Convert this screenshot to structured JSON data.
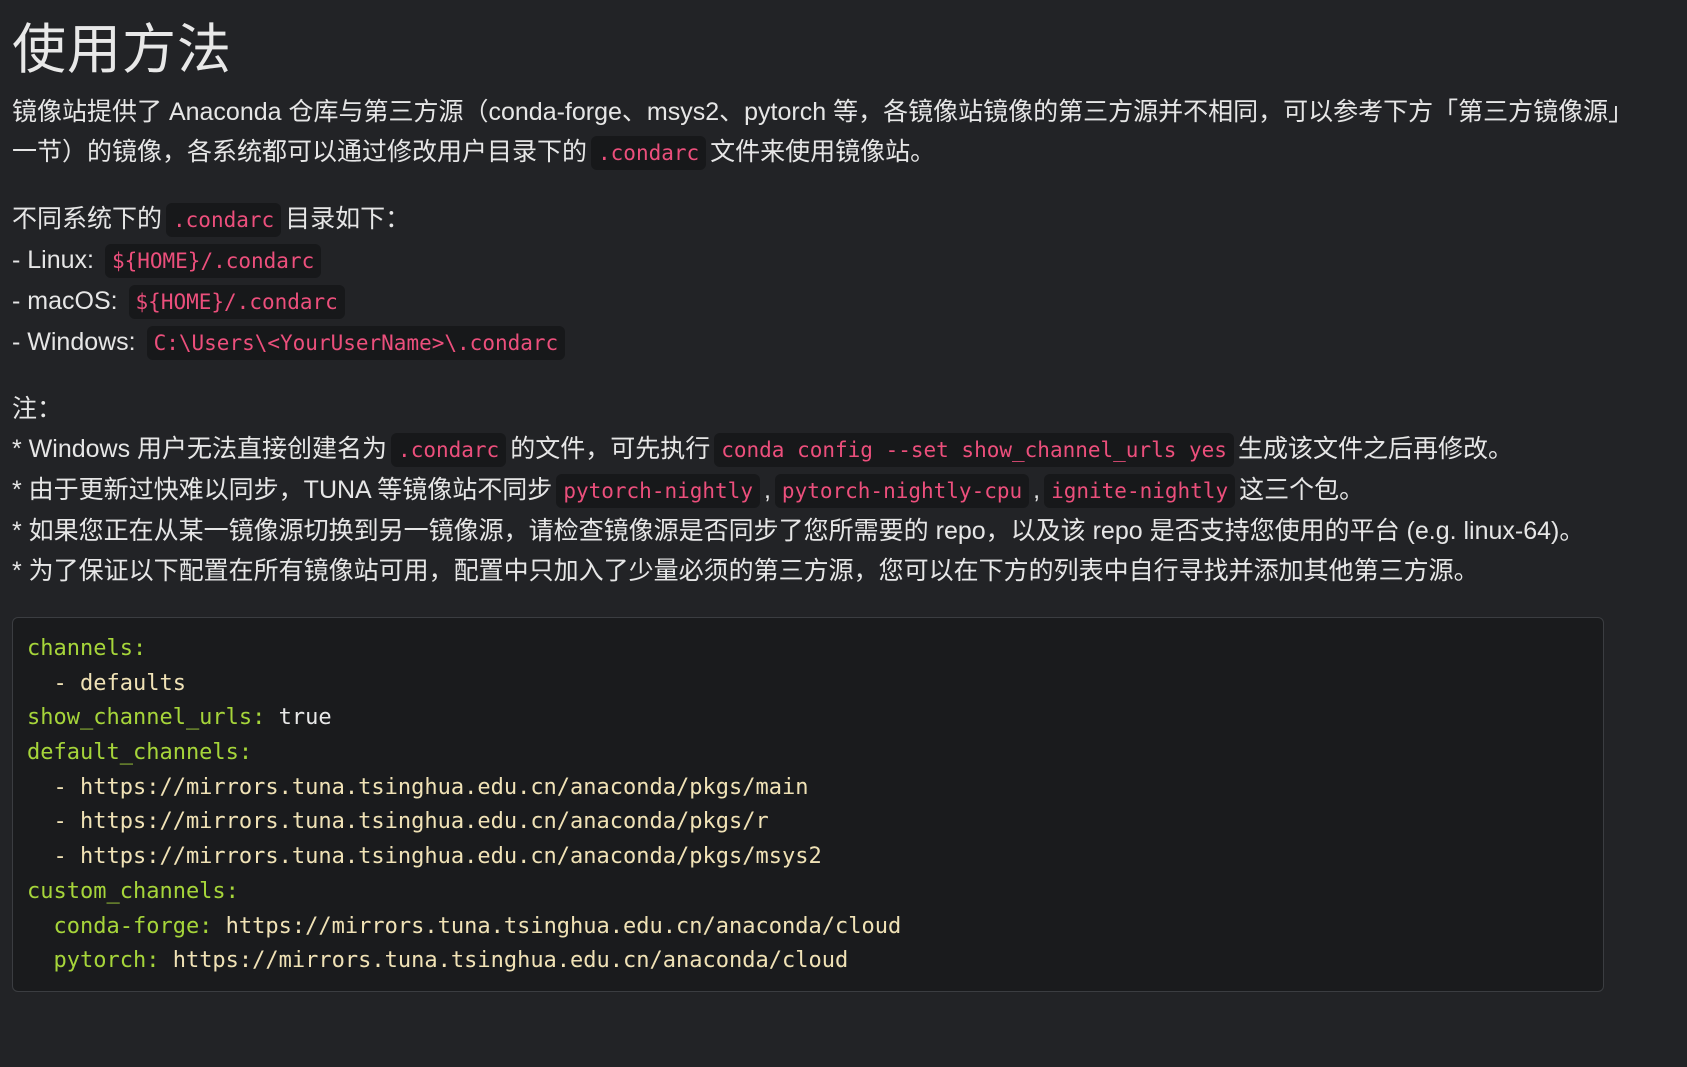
{
  "heading": "使用方法",
  "para1": {
    "t1": "镜像站提供了 Anaconda 仓库与第三方源（conda-forge、msys2、pytorch 等，各镜像站镜像的第三方源并不相同，可以参考下方「第三方镜像源」一节）的镜像，各系统都可以通过修改用户目录下的",
    "c1": ".condarc",
    "t2": "文件来使用镜像站。"
  },
  "dirs": {
    "intro_t1": "不同系统下的",
    "intro_c1": ".condarc",
    "intro_t2": "目录如下：",
    "items": [
      {
        "label": "- Linux:",
        "path": "${HOME}/.condarc"
      },
      {
        "label": "- macOS:",
        "path": "${HOME}/.condarc"
      },
      {
        "label": "- Windows:",
        "path": "C:\\Users\\<YourUserName>\\.condarc"
      }
    ]
  },
  "notes": {
    "title": "注：",
    "n1": {
      "t1": "* Windows 用户无法直接创建名为",
      "c1": ".condarc",
      "t2": "的文件，可先执行",
      "c2": "conda config --set show_channel_urls yes",
      "t3": "生成该文件之后再修改。"
    },
    "n2": {
      "t1": "* 由于更新过快难以同步，TUNA 等镜像站不同步",
      "c1": "pytorch-nightly",
      "s1": ",",
      "c2": "pytorch-nightly-cpu",
      "s2": ",",
      "c3": "ignite-nightly",
      "t2": "这三个包。"
    },
    "n3": "* 如果您正在从某一镜像源切换到另一镜像源，请检查镜像源是否同步了您所需要的 repo，以及该 repo 是否支持您使用的平台 (e.g. linux-64)。",
    "n4": "* 为了保证以下配置在所有镜像站可用，配置中只加入了少量必须的第三方源，您可以在下方的列表中自行寻找并添加其他第三方源。"
  },
  "config": {
    "channels_key": "channels:",
    "channels_item": "  - defaults",
    "show_key": "show_channel_urls:",
    "show_val": " true",
    "default_key": "default_channels:",
    "default_items": [
      "  - https://mirrors.tuna.tsinghua.edu.cn/anaconda/pkgs/main",
      "  - https://mirrors.tuna.tsinghua.edu.cn/anaconda/pkgs/r",
      "  - https://mirrors.tuna.tsinghua.edu.cn/anaconda/pkgs/msys2"
    ],
    "custom_key": "custom_channels:",
    "custom": [
      {
        "key": "  conda-forge:",
        "val": " https://mirrors.tuna.tsinghua.edu.cn/anaconda/cloud"
      },
      {
        "key": "  pytorch:",
        "val": " https://mirrors.tuna.tsinghua.edu.cn/anaconda/cloud"
      }
    ]
  }
}
